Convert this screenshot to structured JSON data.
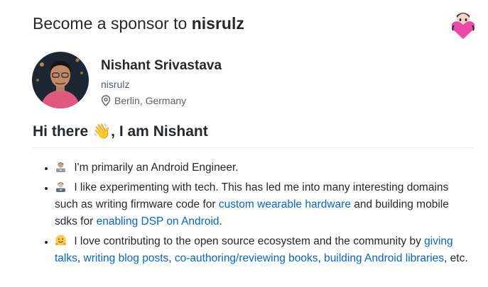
{
  "header": {
    "prefix": "Become a sponsor to",
    "username": "nisrulz",
    "mascot_icon": "sponsor-octocat-heart"
  },
  "profile": {
    "name": "Nishant Srivastava",
    "login": "nisrulz",
    "location": "Berlin, Germany",
    "location_icon": "location-pin-icon"
  },
  "bio": {
    "heading": "Hi there 👋, I am Nishant",
    "items": [
      {
        "icon": "technologist-emoji",
        "text": "I'm primarily an Android Engineer."
      },
      {
        "icon": "man-technologist-emoji",
        "text_1": "I like experimenting with tech. This has led me into many interesting domains such as writing firmware code for ",
        "link_1": "custom wearable hardware",
        "text_2": " and building mobile sdks for ",
        "link_2": "enabling DSP on Android",
        "text_3": "."
      },
      {
        "icon": "hugging-face-emoji",
        "text_1": "I love contributing to the open source ecosystem and the community by ",
        "link_1": "giving talks",
        "sep_1": ", ",
        "link_2": "writing blog posts",
        "sep_2": ", ",
        "link_3": "co-authoring/reviewing books",
        "sep_3": ", ",
        "link_4": "building Android libraries",
        "text_2": ", etc."
      }
    ]
  },
  "colors": {
    "link": "#0366d6",
    "muted": "#586069",
    "text": "#24292e",
    "mascot_pink": "#ea4aaa"
  }
}
